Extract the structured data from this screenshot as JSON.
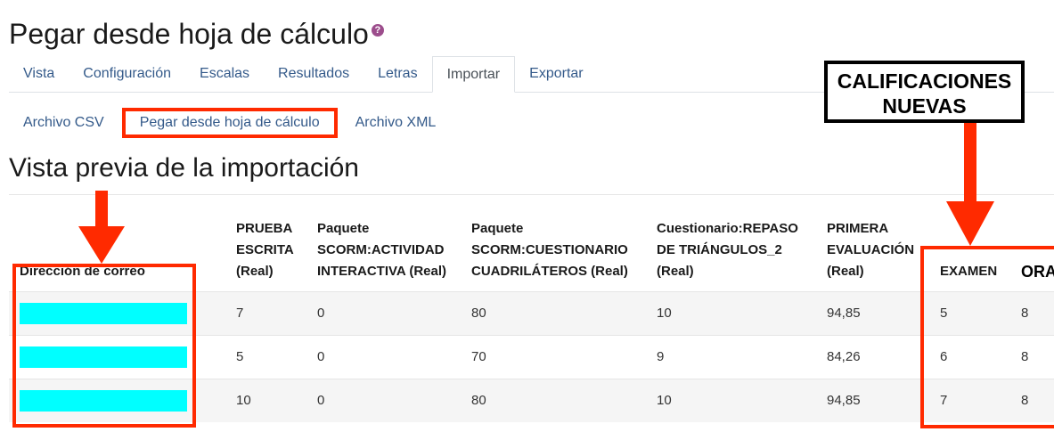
{
  "page": {
    "title": "Pegar desde hoja de cálculo",
    "help_glyph": "?"
  },
  "tabs": [
    {
      "label": "Vista"
    },
    {
      "label": "Configuración"
    },
    {
      "label": "Escalas"
    },
    {
      "label": "Resultados"
    },
    {
      "label": "Letras"
    },
    {
      "label": "Importar"
    },
    {
      "label": "Exportar"
    }
  ],
  "subtabs": [
    {
      "label": "Archivo CSV"
    },
    {
      "label": "Pegar desde hoja de cálculo"
    },
    {
      "label": "Archivo XML"
    }
  ],
  "section": {
    "title": "Vista previa de la importación"
  },
  "callout": {
    "line1": "CALIFICACIONES",
    "line2": "NUEVAS"
  },
  "table": {
    "headers": [
      "Dirección de correo",
      "PRUEBA ESCRITA (Real)",
      "Paquete SCORM:ACTIVIDAD INTERACTIVA (Real)",
      "Paquete SCORM:CUESTIONARIO CUADRILÁTEROS (Real)",
      "Cuestionario:REPASO DE TRIÁNGULOS_2 (Real)",
      "PRIMERA EVALUACIÓN (Real)",
      "EXAMEN",
      "ORAL"
    ],
    "rows": [
      [
        "7",
        "0",
        "80",
        "10",
        "94,85",
        "5",
        "8"
      ],
      [
        "5",
        "0",
        "70",
        "9",
        "84,26",
        "6",
        "8"
      ],
      [
        "10",
        "0",
        "80",
        "10",
        "94,85",
        "7",
        "8"
      ]
    ]
  },
  "colors": {
    "highlight": "#ff2a00",
    "redacted_email": "#00ffff",
    "link": "#345a8a"
  }
}
